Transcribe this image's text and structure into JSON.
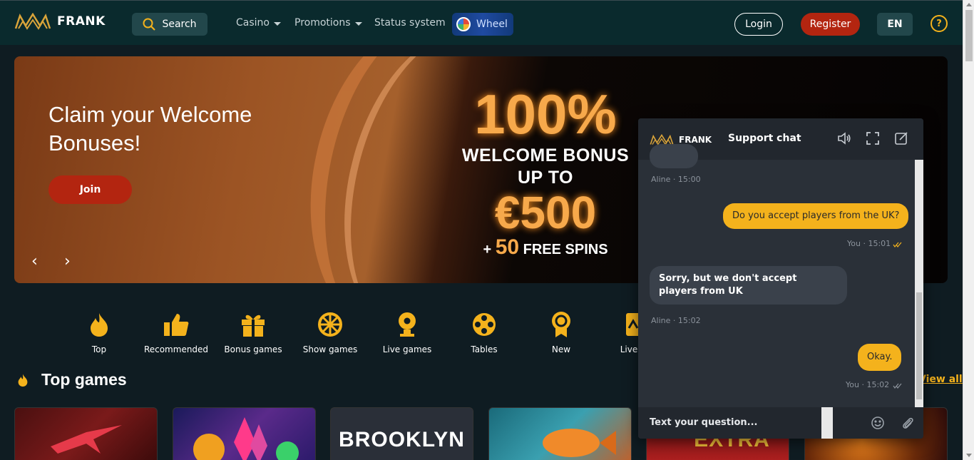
{
  "header": {
    "logo_text": "FRANK",
    "search_label": "Search",
    "nav": [
      {
        "label": "Casino"
      },
      {
        "label": "Promotions"
      },
      {
        "label": "Status system"
      }
    ],
    "wheel_label": "Wheel",
    "login_label": "Login",
    "register_label": "Register",
    "lang_label": "EN",
    "help_label": "?"
  },
  "banner": {
    "title": "Claim your Welcome Bonuses!",
    "join_label": "Join",
    "prev_arrow": "‹",
    "next_arrow": "›",
    "promo_percent": "100%",
    "promo_line1": "WELCOME BONUS",
    "promo_line2": "UP TO",
    "promo_amount": "€500",
    "promo_plus": "+",
    "promo_spins_num": "50",
    "promo_spins_text": "FREE SPINS"
  },
  "categories": [
    {
      "label": "Top",
      "icon": "flame-icon"
    },
    {
      "label": "Recommended",
      "icon": "thumbs-up-icon"
    },
    {
      "label": "Bonus games",
      "icon": "gift-icon"
    },
    {
      "label": "Show games",
      "icon": "wheel-icon"
    },
    {
      "label": "Live games",
      "icon": "webcam-icon"
    },
    {
      "label": "Tables",
      "icon": "reel-icon"
    },
    {
      "label": "New",
      "icon": "award-icon"
    },
    {
      "label": "Live",
      "icon": "live-icon"
    }
  ],
  "section": {
    "title": "Top games",
    "view_all": "View all"
  },
  "tiles": [
    {
      "label": ""
    },
    {
      "label": ""
    },
    {
      "label": "BROOKLYN"
    },
    {
      "label": ""
    },
    {
      "label": "EXTRA"
    },
    {
      "label": ""
    }
  ],
  "chat": {
    "logo_text": "FRANK",
    "title": "Support chat",
    "messages": [
      {
        "meta": "Aline · 15:00"
      },
      {
        "text": "Do you accept players from the UK?",
        "meta": "You · 15:01"
      },
      {
        "text": "Sorry, but we don't accept players from UK",
        "meta": "Aline · 15:02"
      },
      {
        "text": "Okay.",
        "meta": "You · 15:02"
      }
    ],
    "input_placeholder": "Text your question..."
  },
  "colors": {
    "accent": "#f4b21c",
    "register": "#b32510",
    "header_bg": "#0a2a2d",
    "page_bg": "#0f1c22"
  }
}
